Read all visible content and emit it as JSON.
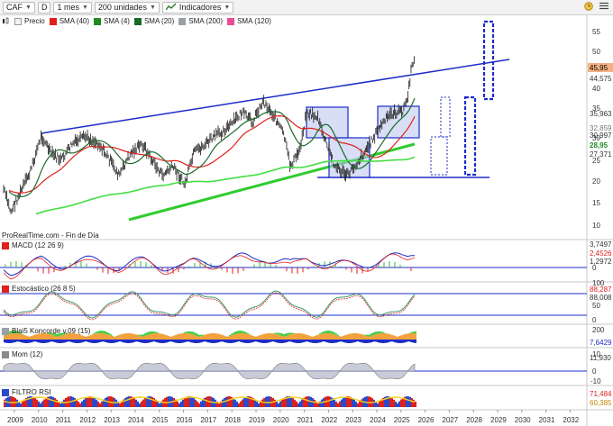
{
  "toolbar": {
    "symbol": "CAF",
    "period_short": "D",
    "timeframe": "1 mes",
    "units": "200 unidades",
    "indicators_label": "Indicadores"
  },
  "legend": [
    {
      "label": "Precio",
      "color": "#f2f2f2"
    },
    {
      "label": "SMA (40)",
      "color": "#e0201b"
    },
    {
      "label": "SMA (4)",
      "color": "#1f8a1f"
    },
    {
      "label": "SMA (20)",
      "color": "#1a6a2a"
    },
    {
      "label": "SMA (200)",
      "color": "#9aa0a6"
    },
    {
      "label": "SMA (120)",
      "color": "#ea4c9a"
    }
  ],
  "watermark": "ProRealTime.com - Fin de Día",
  "price_axis": {
    "ticks": [
      "55",
      "50",
      "40",
      "35",
      "30",
      "25",
      "20",
      "15",
      "10",
      "5"
    ],
    "tags": [
      {
        "text": "45,95",
        "bg": "#f4b183",
        "fg": "#000000"
      },
      {
        "text": "44,575",
        "bg": "#ffffff",
        "fg": "#333333"
      },
      {
        "text": "35,963",
        "bg": "#ffffff",
        "fg": "#333333"
      },
      {
        "text": "32,859",
        "bg": "#ffffff",
        "fg": "#666666"
      },
      {
        "text": "30,997",
        "bg": "#ffffff",
        "fg": "#333333"
      },
      {
        "text": "28,95",
        "bg": "#ffffff",
        "fg": "#1f8a1f"
      },
      {
        "text": "27,371",
        "bg": "#ffffff",
        "fg": "#333333"
      }
    ]
  },
  "panels": {
    "macd": {
      "title": "MACD (12 26 9)",
      "color": "#e0201b",
      "tags": [
        "3,7497",
        "2,4526",
        "1,2972"
      ],
      "zero": "0"
    },
    "stoch": {
      "title": "Estocástico (26 8 5)",
      "color": "#e0201b",
      "tags": [
        "88,287",
        "88,008"
      ],
      "ticks": [
        "100",
        "50",
        "0"
      ]
    },
    "koncorde": {
      "title": "Blai5 Koncorde v.09 (15)",
      "color": "#9aa0a6",
      "tags": [
        "7,6429"
      ],
      "ticks": [
        "200",
        "0"
      ]
    },
    "mom": {
      "title": "Mom (12)",
      "color": "#8a8a8a",
      "tags": [
        "11,930"
      ],
      "ticks": [
        "10",
        "0",
        "-10"
      ]
    },
    "rsi": {
      "title": "FILTRO RSI",
      "color": "#2b4acb",
      "tags": [
        "71,484",
        "60,385"
      ]
    }
  },
  "x_axis": {
    "years": [
      "2009",
      "2010",
      "2011",
      "2012",
      "2013",
      "2014",
      "2015",
      "2016",
      "2017",
      "2018",
      "2019",
      "2020",
      "2021",
      "2022",
      "2023",
      "2024",
      "2025",
      "2026",
      "2027",
      "2028",
      "2029",
      "2030",
      "2031",
      "2032"
    ]
  }
}
